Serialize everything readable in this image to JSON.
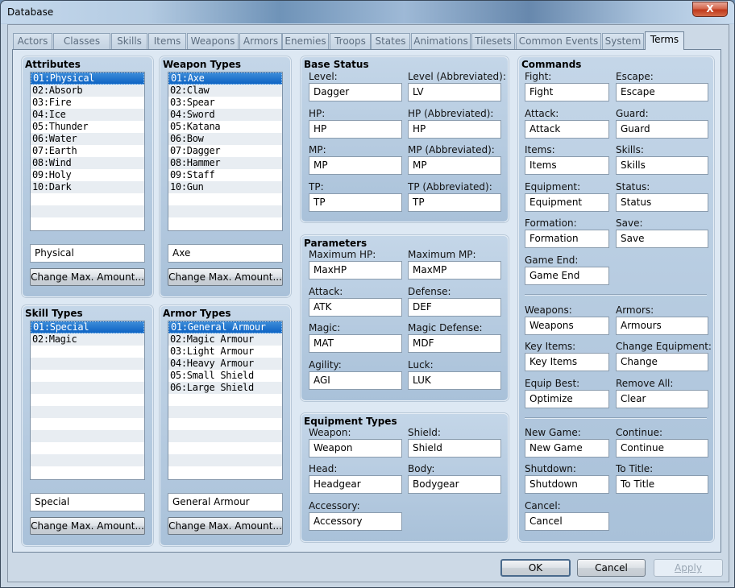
{
  "window": {
    "title": "Database",
    "close_label": "X"
  },
  "tabs": [
    {
      "label": "Actors",
      "active": false
    },
    {
      "label": "Classes",
      "active": false
    },
    {
      "label": "Skills",
      "active": false
    },
    {
      "label": "Items",
      "active": false
    },
    {
      "label": "Weapons",
      "active": false
    },
    {
      "label": "Armors",
      "active": false
    },
    {
      "label": "Enemies",
      "active": false
    },
    {
      "label": "Troops",
      "active": false
    },
    {
      "label": "States",
      "active": false
    },
    {
      "label": "Animations",
      "active": false
    },
    {
      "label": "Tilesets",
      "active": false
    },
    {
      "label": "Common Events",
      "active": false
    },
    {
      "label": "System",
      "active": false
    },
    {
      "label": "Terms",
      "active": true
    }
  ],
  "attributes": {
    "title": "Attributes",
    "items": [
      "01:Physical",
      "02:Absorb",
      "03:Fire",
      "04:Ice",
      "05:Thunder",
      "06:Water",
      "07:Earth",
      "08:Wind",
      "09:Holy",
      "10:Dark"
    ],
    "selected_index": 0,
    "name_value": "Physical",
    "change_max_label": "Change Max. Amount..."
  },
  "weapon_types": {
    "title": "Weapon Types",
    "items": [
      "01:Axe",
      "02:Claw",
      "03:Spear",
      "04:Sword",
      "05:Katana",
      "06:Bow",
      "07:Dagger",
      "08:Hammer",
      "09:Staff",
      "10:Gun"
    ],
    "selected_index": 0,
    "name_value": "Axe",
    "change_max_label": "Change Max. Amount..."
  },
  "skill_types": {
    "title": "Skill Types",
    "items": [
      "01:Special",
      "02:Magic"
    ],
    "selected_index": 0,
    "name_value": "Special",
    "change_max_label": "Change Max. Amount..."
  },
  "armor_types": {
    "title": "Armor Types",
    "items": [
      "01:General Armour",
      "02:Magic Armour",
      "03:Light Armour",
      "04:Heavy Armour",
      "05:Small Shield",
      "06:Large Shield"
    ],
    "selected_index": 0,
    "name_value": "General Armour",
    "change_max_label": "Change Max. Amount..."
  },
  "base_status": {
    "title": "Base Status",
    "fields": [
      {
        "label": "Level:",
        "value": "Dagger"
      },
      {
        "label": "Level (Abbreviated):",
        "value": "LV"
      },
      {
        "label": "HP:",
        "value": "HP"
      },
      {
        "label": "HP (Abbreviated):",
        "value": "HP"
      },
      {
        "label": "MP:",
        "value": "MP"
      },
      {
        "label": "MP (Abbreviated):",
        "value": "MP"
      },
      {
        "label": "TP:",
        "value": "TP"
      },
      {
        "label": "TP (Abbreviated):",
        "value": "TP"
      }
    ]
  },
  "parameters": {
    "title": "Parameters",
    "fields": [
      {
        "label": "Maximum HP:",
        "value": "MaxHP"
      },
      {
        "label": "Maximum MP:",
        "value": "MaxMP"
      },
      {
        "label": "Attack:",
        "value": "ATK"
      },
      {
        "label": "Defense:",
        "value": "DEF"
      },
      {
        "label": "Magic:",
        "value": "MAT"
      },
      {
        "label": "Magic Defense:",
        "value": "MDF"
      },
      {
        "label": "Agility:",
        "value": "AGI"
      },
      {
        "label": "Luck:",
        "value": "LUK"
      }
    ]
  },
  "equipment_types": {
    "title": "Equipment Types",
    "fields": [
      {
        "label": "Weapon:",
        "value": "Weapon"
      },
      {
        "label": "Shield:",
        "value": "Shield"
      },
      {
        "label": "Head:",
        "value": "Headgear"
      },
      {
        "label": "Body:",
        "value": "Bodygear"
      },
      {
        "label": "Accessory:",
        "value": "Accessory"
      }
    ]
  },
  "commands": {
    "title": "Commands",
    "fields": [
      {
        "label": "Fight:",
        "value": "Fight"
      },
      {
        "label": "Escape:",
        "value": "Escape"
      },
      {
        "label": "Attack:",
        "value": "Attack"
      },
      {
        "label": "Guard:",
        "value": "Guard"
      },
      {
        "label": "Items:",
        "value": "Items"
      },
      {
        "label": "Skills:",
        "value": "Skills"
      },
      {
        "label": "Equipment:",
        "value": "Equipment"
      },
      {
        "label": "Status:",
        "value": "Status"
      },
      {
        "label": "Formation:",
        "value": "Formation"
      },
      {
        "label": "Save:",
        "value": "Save"
      },
      {
        "label": "Game End:",
        "value": "Game End"
      },
      {
        "label": "Weapons:",
        "value": "Weapons"
      },
      {
        "label": "Armors:",
        "value": "Armours"
      },
      {
        "label": "Key Items:",
        "value": "Key Items"
      },
      {
        "label": "Change Equipment:",
        "value": "Change"
      },
      {
        "label": "Equip Best:",
        "value": "Optimize"
      },
      {
        "label": "Remove All:",
        "value": "Clear"
      },
      {
        "label": "New Game:",
        "value": "New Game"
      },
      {
        "label": "Continue:",
        "value": "Continue"
      },
      {
        "label": "Shutdown:",
        "value": "Shutdown"
      },
      {
        "label": "To Title:",
        "value": "To Title"
      },
      {
        "label": "Cancel:",
        "value": "Cancel"
      }
    ]
  },
  "footer": {
    "ok_label": "OK",
    "cancel_label": "Cancel",
    "apply_label": "Apply",
    "apply_enabled": false
  }
}
